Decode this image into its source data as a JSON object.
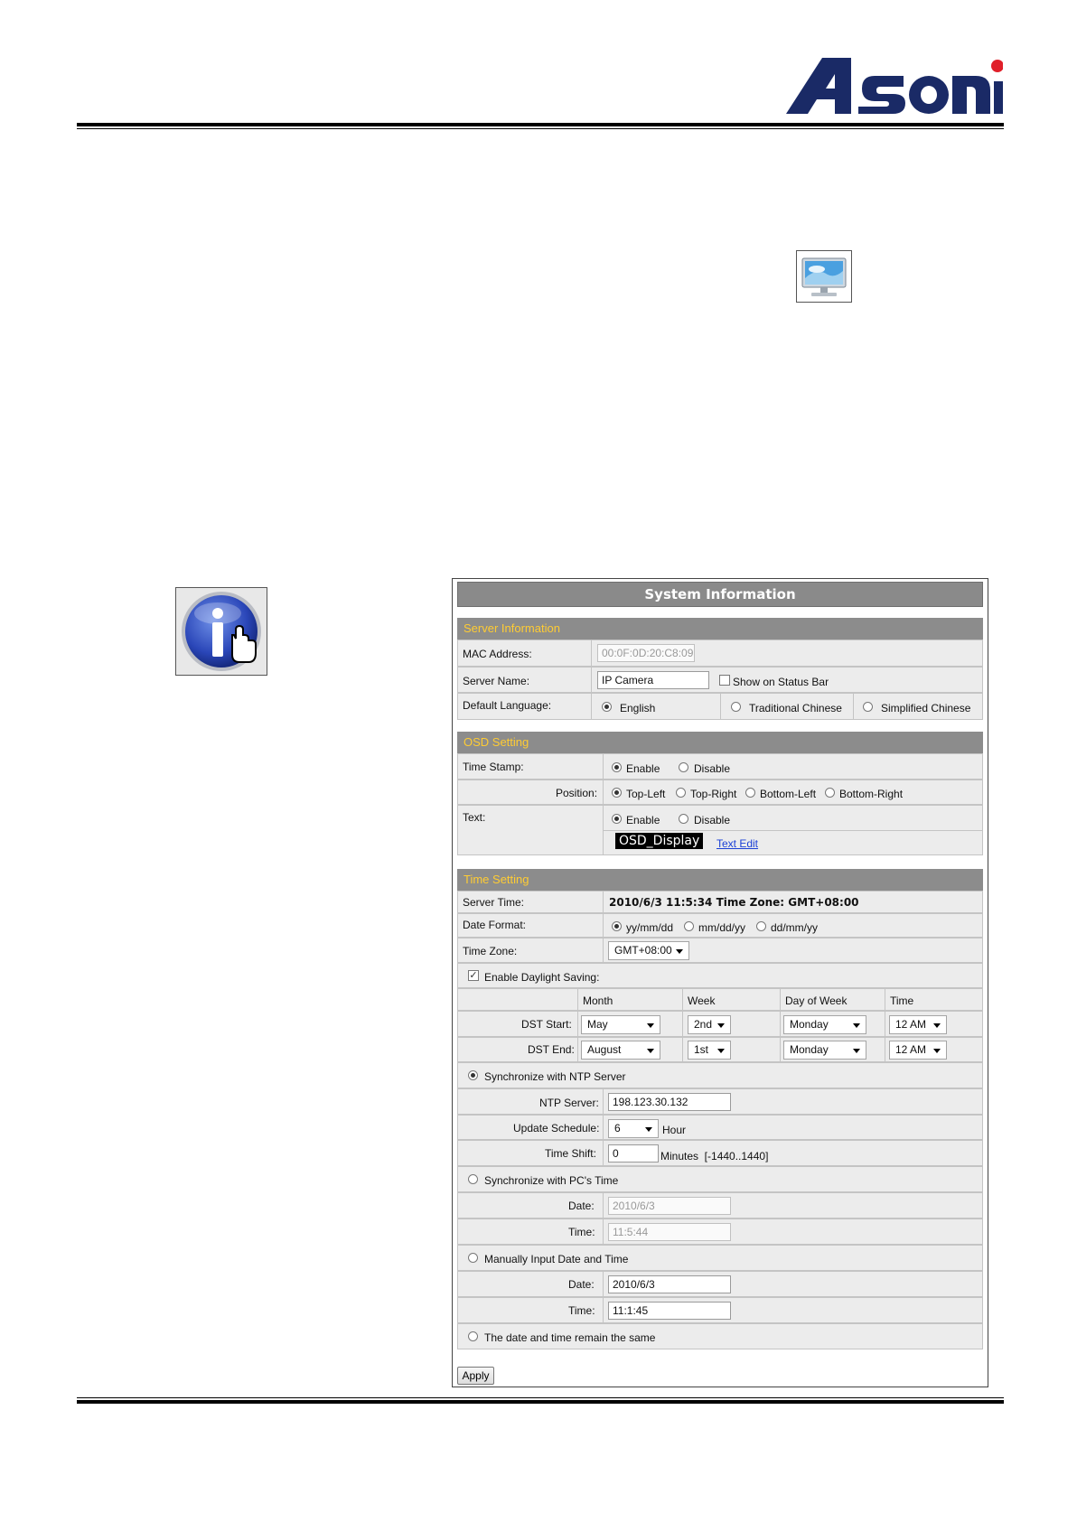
{
  "panel_title": "System Information",
  "sections": {
    "server": "Server Information",
    "osd": "OSD Setting",
    "time": "Time Setting"
  },
  "server": {
    "mac_label": "MAC Address:",
    "mac_value": "00:0F:0D:20:C8:09",
    "name_label": "Server Name:",
    "name_value": "IP Camera",
    "show_status_label": "Show on Status Bar",
    "lang_label": "Default Language:",
    "lang_options": [
      "English",
      "Traditional Chinese",
      "Simplified Chinese"
    ]
  },
  "osd": {
    "timestamp_label": "Time Stamp:",
    "enable": "Enable",
    "disable": "Disable",
    "position_label": "Position:",
    "positions": [
      "Top-Left",
      "Top-Right",
      "Bottom-Left",
      "Bottom-Right"
    ],
    "text_label": "Text:",
    "osd_text": "OSD_Display",
    "text_edit": "Text Edit"
  },
  "time": {
    "server_time_label": "Server Time:",
    "server_time_value": "2010/6/3 11:5:34 Time Zone: GMT+08:00",
    "date_format_label": "Date Format:",
    "date_formats": [
      "yy/mm/dd",
      "mm/dd/yy",
      "dd/mm/yy"
    ],
    "time_zone_label": "Time Zone:",
    "time_zone_value": "GMT+08:00",
    "dst_label": "Enable Daylight Saving:",
    "dst_headers": [
      "Month",
      "Week",
      "Day of Week",
      "Time"
    ],
    "dst_start_label": "DST Start:",
    "dst_start": [
      "May",
      "2nd",
      "Monday",
      "12 AM"
    ],
    "dst_end_label": "DST End:",
    "dst_end": [
      "August",
      "1st",
      "Monday",
      "12 AM"
    ],
    "ntp_sync_label": "Synchronize with NTP Server",
    "ntp_server_label": "NTP Server:",
    "ntp_server_value": "198.123.30.132",
    "update_label": "Update Schedule:",
    "update_value": "6",
    "update_unit": "Hour",
    "shift_label": "Time Shift:",
    "shift_value": "0",
    "shift_unit": "Minutes  [-1440..1440]",
    "pc_sync_label": "Synchronize with PC's Time",
    "date_label": "Date:",
    "time_label": "Time:",
    "pc_date": "2010/6/3",
    "pc_time": "11:5:44",
    "manual_label": "Manually Input Date and Time",
    "manual_date": "2010/6/3",
    "manual_time": "11:1:45",
    "same_label": "The date and time remain the same"
  },
  "apply_label": "Apply",
  "colors": {
    "section_text": "#ffcc33",
    "section_bg": "#8c8c8c",
    "logo": "#1a2a66",
    "logo_dot": "#e0202a"
  }
}
